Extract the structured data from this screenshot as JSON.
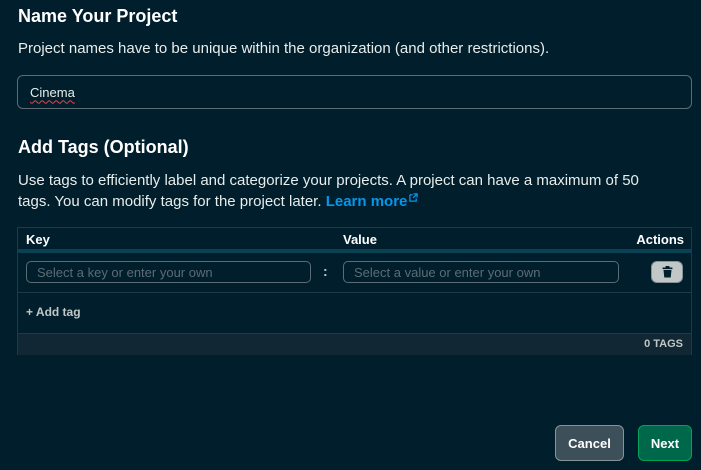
{
  "name_section": {
    "title": "Name Your Project",
    "description": "Project names have to be unique within the organization (and other restrictions).",
    "input_value": "Cinema"
  },
  "tags_section": {
    "title": "Add Tags (Optional)",
    "description_line1": "Use tags to efficiently label and categorize your projects. A project can have a maximum of 50",
    "description_line2": "tags. You can modify tags for the project later.",
    "learn_more": "Learn more"
  },
  "tags_table": {
    "columns": {
      "key": "Key",
      "value": "Value",
      "actions": "Actions"
    },
    "row": {
      "key_placeholder": "Select a key or enter your own",
      "separator": ":",
      "value_placeholder": "Select a value or enter your own"
    },
    "add_tag": "+ Add tag",
    "count": "0 TAGS"
  },
  "footer": {
    "cancel": "Cancel",
    "next": "Next"
  },
  "colors": {
    "background": "#001e2b",
    "link": "#0498ec",
    "primary": "#00684a"
  },
  "icons": [
    "external-link-icon",
    "trash-icon"
  ]
}
